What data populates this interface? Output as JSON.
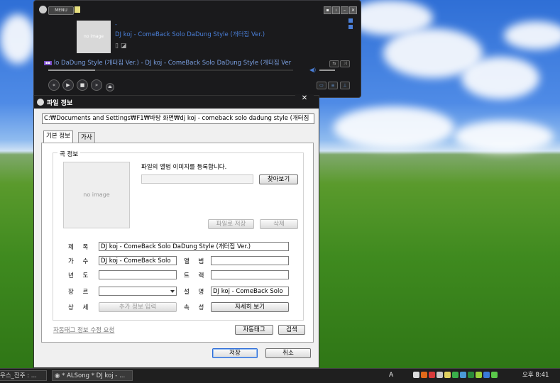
{
  "player": {
    "menu_label": "MENU",
    "album_art_text": "no image",
    "track_dash": "-",
    "track_title": "DJ koj - ComeBack Solo DaDung Style (개터짐 Ver.)",
    "scroll_text": "lo DaDung Style (개터짐 Ver.) - DJ koj - ComeBack Solo DaDung Style (개터짐 Ver",
    "progress": 0.19,
    "volume": 0.6
  },
  "dialog": {
    "title": "파일 정보",
    "close": "✕",
    "path": "C:₩Documents and Settings₩F1₩바탕 화면₩dj koj - comeback solo dadung style (개터짐",
    "tabs": [
      {
        "label": "기본 정보"
      },
      {
        "label": "가사"
      }
    ],
    "group_label": "곡 정보",
    "no_image": "no image",
    "register_text": "파일의 앨범 이미지를 등록합니다.",
    "browse_button": "찾아보기",
    "save_to_file_button": "파일로 저장",
    "delete_button": "삭제",
    "fields": {
      "title_label": "제 목",
      "title_value": "DJ koj - ComeBack Solo DaDung Style (개터짐 Ver.)",
      "artist_label": "가 수",
      "artist_value": "DJ koj - ComeBack Solo",
      "album_label": "앨 범",
      "album_value": "",
      "year_label": "년 도",
      "year_value": "",
      "track_label": "트 랙",
      "track_value": "",
      "genre_label": "장 르",
      "genre_value": "",
      "comment_label": "설 명",
      "comment_value": "DJ koj - ComeBack Solo",
      "detail_label": "상 세",
      "detail_button": "추가 정보 입력",
      "property_label": "속 성",
      "property_button": "자세히 보기"
    },
    "auto_tag_link": "자동태그 정보 수정 요청",
    "auto_tag_button": "자동태그",
    "search_button": "검색",
    "save_button": "저장",
    "cancel_button": "취소"
  },
  "taskbar": {
    "item1": "우스_진주 : ...",
    "item2": "* ALSong * DJ koj - ...",
    "tray_lang": "A",
    "clock": "오후 8:41"
  }
}
